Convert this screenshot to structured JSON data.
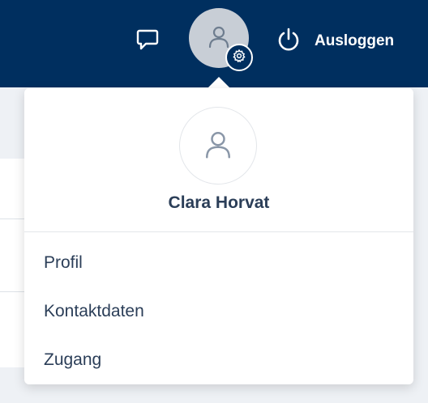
{
  "header": {
    "logout_label": "Ausloggen",
    "icons": {
      "chat": "chat-icon",
      "user": "user-icon",
      "settings": "gear-icon",
      "power": "power-icon"
    }
  },
  "profile_menu": {
    "user_name": "Clara Horvat",
    "items": [
      {
        "label": "Profil"
      },
      {
        "label": "Kontaktdaten"
      },
      {
        "label": "Zugang"
      }
    ]
  },
  "colors": {
    "header_bg": "#002f5f",
    "text_primary": "#2b3e58",
    "avatar_bg": "#c8ced6"
  }
}
